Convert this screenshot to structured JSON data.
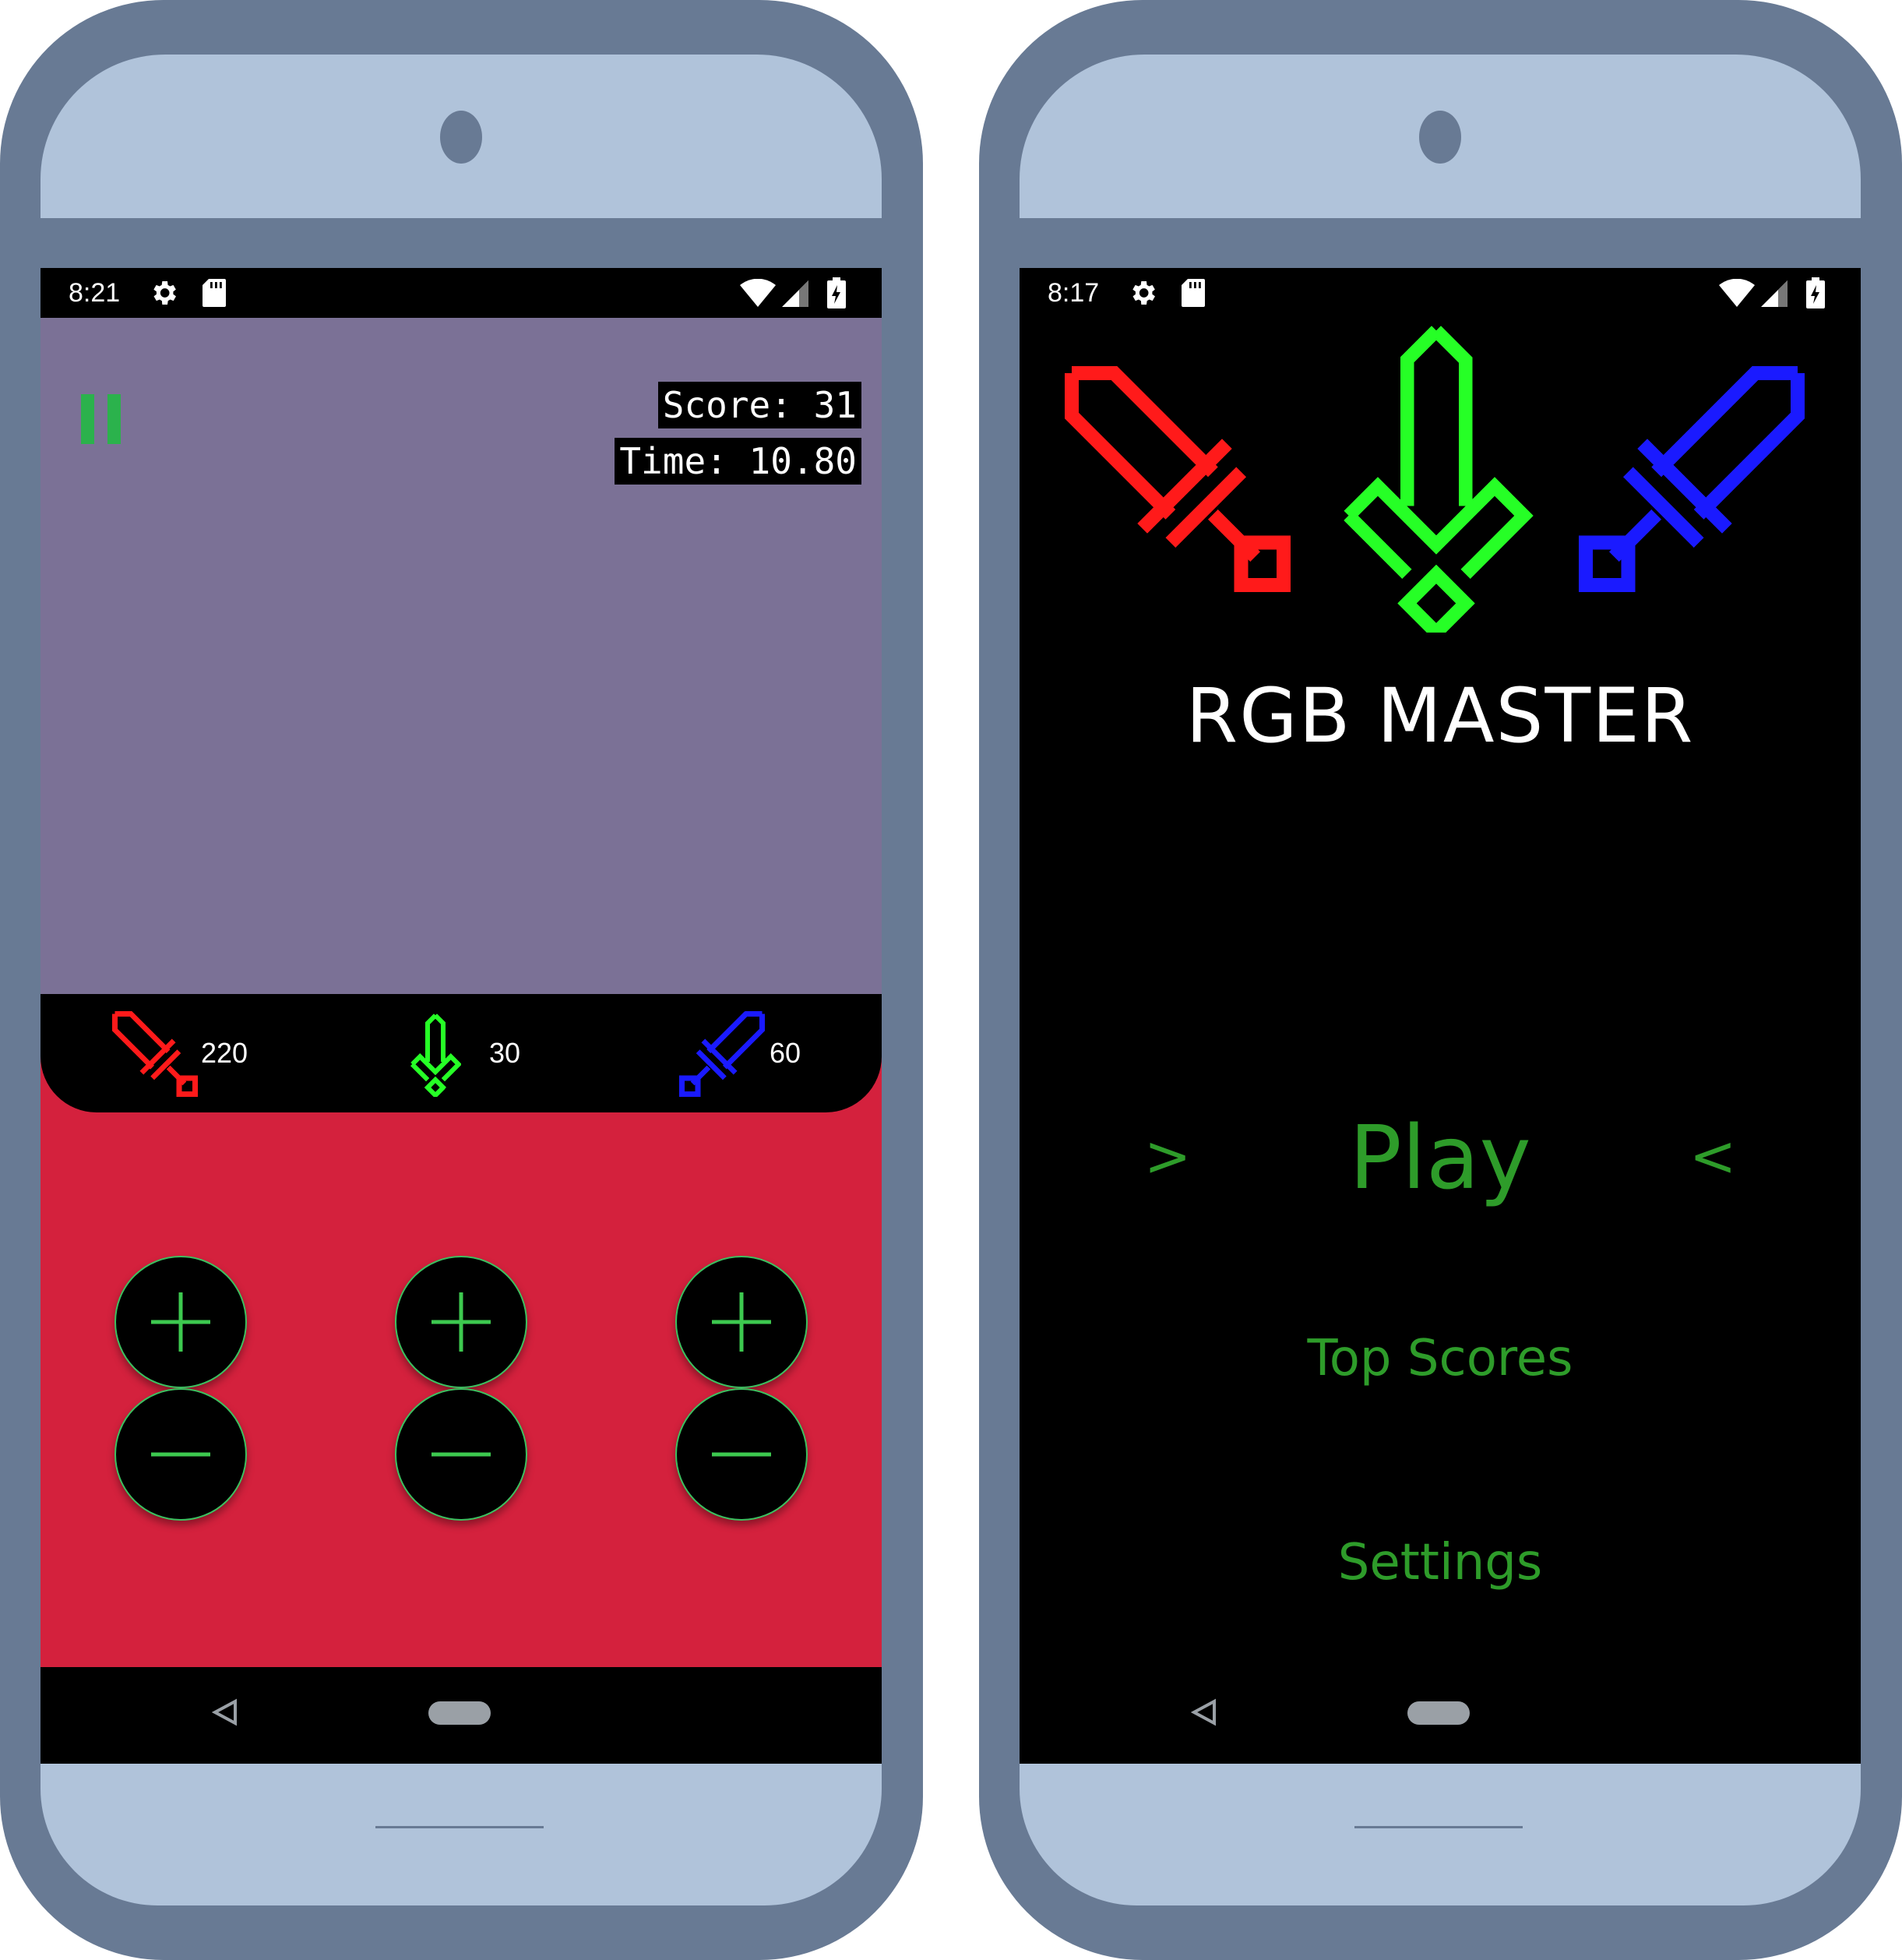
{
  "colors": {
    "phone_frame": "#687a94",
    "phone_bezel": "#b0c3da",
    "camera": "#687a94",
    "game_top_bg": "#7b7196",
    "game_bottom_bg": "#d4213d",
    "accent_green": "#2e9c2a",
    "pause_green": "#2bb24c",
    "button_plus_green": "#3dc94f",
    "sword_red": "#ff1a1a",
    "sword_green": "#26ff26",
    "sword_blue": "#1a1aff",
    "nav_gray": "#9aa0a6"
  },
  "game_screen": {
    "statusbar": {
      "time": "8:21",
      "icons": [
        "gear-icon",
        "sd-card-icon",
        "wifi-icon",
        "signal-icon",
        "battery-charging-icon"
      ]
    },
    "pause_icon": "pause-icon",
    "score_label": "Score: 31",
    "time_label": "Time: 10.80",
    "counters": [
      {
        "icon": "red-sword-icon",
        "value": "220"
      },
      {
        "icon": "green-sword-icon",
        "value": "30"
      },
      {
        "icon": "blue-sword-icon",
        "value": "60"
      }
    ],
    "controls": [
      {
        "plus_icon": "plus-icon",
        "minus_icon": "minus-icon"
      },
      {
        "plus_icon": "plus-icon",
        "minus_icon": "minus-icon"
      },
      {
        "plus_icon": "plus-icon",
        "minus_icon": "minus-icon"
      }
    ],
    "navbar": {
      "back_icon": "back-triangle-icon",
      "home_icon": "home-pill-icon"
    }
  },
  "menu_screen": {
    "statusbar": {
      "time": "8:17",
      "icons": [
        "gear-icon",
        "sd-card-icon",
        "wifi-icon",
        "signal-icon",
        "battery-charging-icon"
      ]
    },
    "logo_icons": [
      "red-sword-icon",
      "green-sword-icon",
      "blue-sword-icon"
    ],
    "title": "RGB MASTER",
    "play": {
      "label": "Play",
      "left_chevron": ">",
      "right_chevron": "<"
    },
    "top_scores": "Top Scores",
    "settings": "Settings",
    "navbar": {
      "back_icon": "back-triangle-icon",
      "home_icon": "home-pill-icon"
    }
  }
}
